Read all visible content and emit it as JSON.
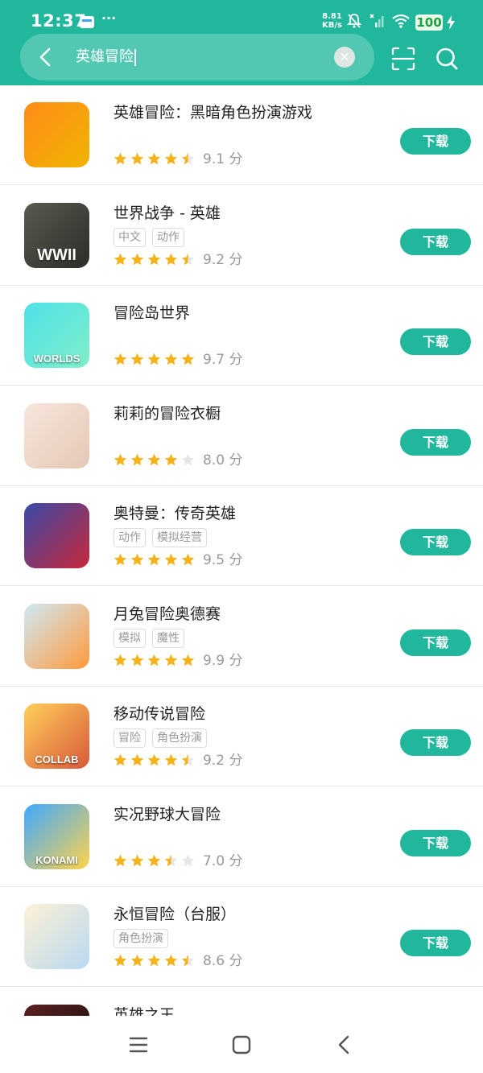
{
  "status_bar": {
    "time": "12:37",
    "dots": "···",
    "speed": "8.81\nKB/s",
    "battery": "100"
  },
  "search": {
    "query": "英雄冒险"
  },
  "apps": [
    {
      "title": "英雄冒险：黑暗角色扮演游戏",
      "tags": [],
      "rating": 4.5,
      "score": "9.1 分",
      "button": "下载",
      "icon": "rifle-icon",
      "colors": [
        "#ff8c1a",
        "#f0b400"
      ]
    },
    {
      "title": "世界战争 - 英雄",
      "tags": [
        "中文",
        "动作"
      ],
      "rating": 4.5,
      "score": "9.2 分",
      "button": "下载",
      "icon": "wwii-icon",
      "icon_text": "WWII",
      "colors": [
        "#5a5a52",
        "#2d2d28"
      ]
    },
    {
      "title": "冒险岛世界",
      "tags": [],
      "rating": 5,
      "score": "9.7 分",
      "button": "下载",
      "icon": "maplestory-worlds-icon",
      "icon_text": "WORLDS",
      "colors": [
        "#4ee0e8",
        "#7ff0c9"
      ]
    },
    {
      "title": "莉莉的冒险衣橱",
      "tags": [],
      "rating": 4,
      "score": "8.0 分",
      "button": "下载",
      "icon": "anime-girl-icon",
      "colors": [
        "#f7e6dc",
        "#e5c7b5"
      ]
    },
    {
      "title": "奥特曼：传奇英雄",
      "tags": [
        "动作",
        "模拟经营"
      ],
      "rating": 5,
      "score": "9.5 分",
      "button": "下载",
      "icon": "ultraman-icon",
      "colors": [
        "#3a4aa8",
        "#c8283a"
      ]
    },
    {
      "title": "月兔冒险奥德赛",
      "tags": [
        "模拟",
        "魔性"
      ],
      "rating": 5,
      "score": "9.9 分",
      "button": "下载",
      "icon": "rabbit-carrot-icon",
      "colors": [
        "#cfe9f5",
        "#ff9a3c"
      ]
    },
    {
      "title": "移动传说冒险",
      "tags": [
        "冒险",
        "角色扮演"
      ],
      "rating": 4.5,
      "score": "9.2 分",
      "button": "下载",
      "icon": "collab-icon",
      "icon_text": "COLLAB",
      "colors": [
        "#ffcf5a",
        "#d8583a"
      ]
    },
    {
      "title": "实况野球大冒险",
      "tags": [],
      "rating": 3.5,
      "score": "7.0 分",
      "button": "下载",
      "icon": "baseball-icon",
      "icon_text": "KONAMI",
      "colors": [
        "#3ea8ff",
        "#ffd34a"
      ]
    },
    {
      "title": "永恒冒险（台服）",
      "tags": [
        "角色扮演"
      ],
      "rating": 4.5,
      "score": "8.6 分",
      "button": "下载",
      "icon": "fantasy-hero-icon",
      "colors": [
        "#fdf1d6",
        "#b8d8f0"
      ]
    },
    {
      "title": "英雄之王",
      "tags": [],
      "rating": 0,
      "score": "",
      "button": "",
      "icon": "dark-hair-icon",
      "colors": [
        "#5a2020",
        "#1a1010"
      ]
    }
  ],
  "colors": {
    "accent": "#20b79c",
    "star_filled": "#f5b31b",
    "star_empty": "#e6e6e6"
  }
}
